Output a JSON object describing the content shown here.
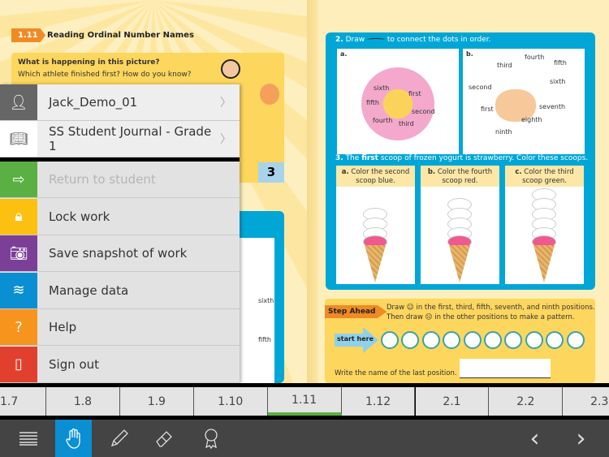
{
  "left_page": {
    "lesson_tag": "1.11",
    "lesson_title": "Reading Ordinal Number Names",
    "question1": "What is happening in this picture?",
    "question2": "Which athlete finished first? How do you know?",
    "place_number": "3",
    "labels": [
      "sixth",
      "fifth"
    ]
  },
  "right_page": {
    "q2": {
      "num": "2.",
      "text_before": "Draw",
      "text_after": "to connect the dots in order.",
      "a": {
        "label": "a.",
        "dots": [
          "sixth",
          "first",
          "fifth",
          "second",
          "fourth",
          "third"
        ]
      },
      "b": {
        "label": "b.",
        "dots": [
          "fourth",
          "third",
          "fifth",
          "sixth",
          "second",
          "first",
          "seventh",
          "eighth",
          "ninth"
        ]
      }
    },
    "q3": {
      "num": "3.",
      "text_pre": "The",
      "bold": "first",
      "text_post": "scoop of frozen yogurt is strawberry. Color these scoops.",
      "boxes": [
        {
          "label": "a.",
          "text": "Color the second scoop blue."
        },
        {
          "label": "b.",
          "text": "Color the fourth scoop red."
        },
        {
          "label": "c.",
          "text": "Color the third scoop green."
        }
      ]
    },
    "step_ahead": {
      "tag": "Step Ahead",
      "line1": "Draw ☺ in the first, third, fifth, seventh, and ninth positions.",
      "line2": "Then draw ☹ in the other positions to make a pattern.",
      "start_label": "start here",
      "circle_count": 10,
      "write_prompt": "Write the name of the last position."
    }
  },
  "menu": {
    "items": [
      {
        "label": "Jack_Demo_01",
        "icon": "user-icon",
        "color": "#666666",
        "chevron": "〉"
      },
      {
        "label": "SS Student Journal - Grade 1",
        "icon": "book-icon",
        "color": "#ffffff",
        "chevron": "〉"
      },
      {
        "label": "Return to student",
        "icon": "arrow-right-icon",
        "color": "#5ab043",
        "disabled": true
      },
      {
        "label": "Lock work",
        "icon": "lock-icon",
        "color": "#fcc010"
      },
      {
        "label": "Save snapshot of work",
        "icon": "camera-icon",
        "color": "#7c3f98"
      },
      {
        "label": "Manage data",
        "icon": "database-icon",
        "color": "#0a8fd3"
      },
      {
        "label": "Help",
        "icon": "question-icon",
        "color": "#f7941d"
      },
      {
        "label": "Sign out",
        "icon": "door-icon",
        "color": "#e2402f"
      }
    ]
  },
  "tabs": {
    "items": [
      "1.7",
      "1.8",
      "1.9",
      "1.10",
      "1.11",
      "1.12",
      "2.1",
      "2.2",
      "2.3"
    ],
    "active": "1.11",
    "active_color": "#5ab043"
  },
  "toolbar": {
    "tools": [
      "menu-icon",
      "hand-icon",
      "pencil-icon",
      "eraser-icon",
      "award-icon"
    ],
    "active": "hand-icon",
    "active_color": "#0a8fd3",
    "prev": "‹",
    "next": "›"
  }
}
